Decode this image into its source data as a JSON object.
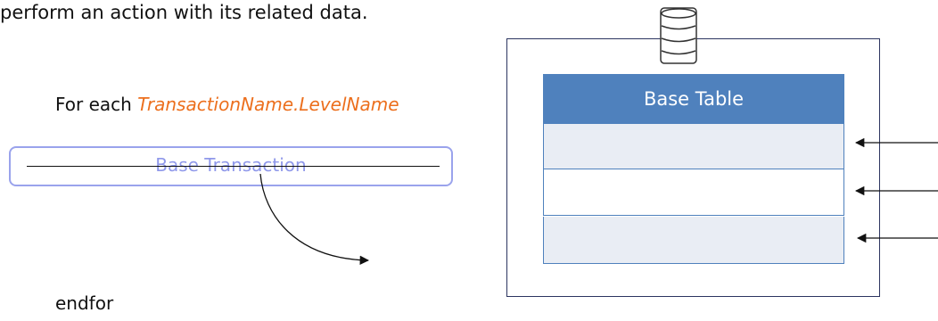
{
  "intro_text": "perform an action with its related data.",
  "for_each": {
    "keyword": "For each ",
    "level_name": "TransactionName.LevelName"
  },
  "base_transaction": {
    "label": "Base Transaction"
  },
  "endfor": "endfor",
  "base_table": {
    "header": "Base Table",
    "rows": [
      "",
      "",
      ""
    ]
  },
  "icons": {
    "database": "database-icon"
  },
  "colors": {
    "level_name": "#ec6f1d",
    "base_transaction_border": "#9aa3ec",
    "table_header": "#4f81bd",
    "table_row_shaded": "#e9edf4",
    "frame_border": "#2c3560"
  }
}
